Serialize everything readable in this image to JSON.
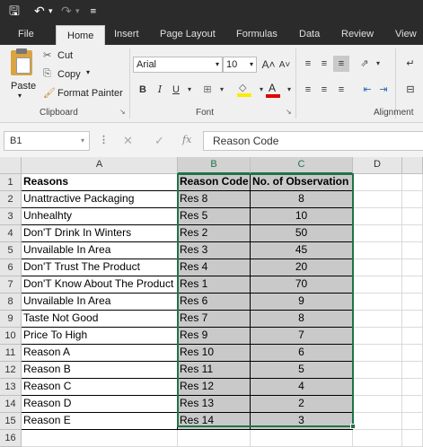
{
  "ribbon": {
    "tabs": [
      "File",
      "Home",
      "Insert",
      "Page Layout",
      "Formulas",
      "Data",
      "Review",
      "View"
    ],
    "clipboard": {
      "cut": "Cut",
      "copy": "Copy",
      "paste": "Paste",
      "format_painter": "Format Painter",
      "label": "Clipboard"
    },
    "font": {
      "name": "Arial",
      "size": "10",
      "label": "Font",
      "bold": "B",
      "italic": "I",
      "underline": "U"
    },
    "alignment": {
      "label": "Alignment"
    }
  },
  "formula_bar": {
    "name_box": "B1",
    "fx": "fx",
    "content": "Reason Code"
  },
  "columns": [
    "A",
    "B",
    "C",
    "D"
  ],
  "headers": {
    "reasons": "Reasons",
    "reason_code": "Reason Code",
    "observations": "No. of Observation"
  },
  "rows": [
    {
      "n": "1"
    },
    {
      "n": "2",
      "reason": "Unattractive Packaging",
      "code": "Res 8",
      "obs": "8"
    },
    {
      "n": "3",
      "reason": "Unhealhty",
      "code": "Res 5",
      "obs": "10"
    },
    {
      "n": "4",
      "reason": "Don'T Drink In Winters",
      "code": "Res 2",
      "obs": "50"
    },
    {
      "n": "5",
      "reason": "Unvailable In Area",
      "code": "Res 3",
      "obs": "45"
    },
    {
      "n": "6",
      "reason": "Don'T Trust The Product",
      "code": "Res 4",
      "obs": "20"
    },
    {
      "n": "7",
      "reason": "Don'T Know About The Product",
      "code": "Res 1",
      "obs": "70"
    },
    {
      "n": "8",
      "reason": "Unvailable In Area",
      "code": "Res 6",
      "obs": "9"
    },
    {
      "n": "9",
      "reason": "Taste Not Good",
      "code": "Res 7",
      "obs": "8"
    },
    {
      "n": "10",
      "reason": "Price To High",
      "code": "Res 9",
      "obs": "7"
    },
    {
      "n": "11",
      "reason": "Reason A",
      "code": "Res 10",
      "obs": "6"
    },
    {
      "n": "12",
      "reason": "Reason B",
      "code": "Res 11",
      "obs": "5"
    },
    {
      "n": "13",
      "reason": "Reason C",
      "code": "Res 12",
      "obs": "4"
    },
    {
      "n": "14",
      "reason": "Reason D",
      "code": "Res 13",
      "obs": "2"
    },
    {
      "n": "15",
      "reason": "Reason E",
      "code": "Res 14",
      "obs": "3"
    },
    {
      "n": "16"
    }
  ],
  "colors": {
    "accent": "#217346",
    "selected_fill": "#c9c9c9",
    "titlebar": "#2b2b2b"
  }
}
